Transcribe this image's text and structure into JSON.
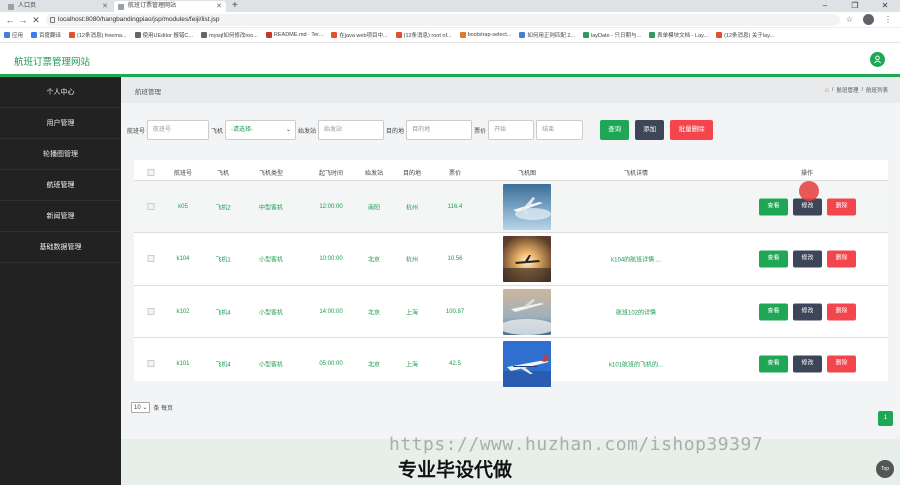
{
  "browser": {
    "tabs": [
      {
        "title": "人口页"
      },
      {
        "title": "航班订票管理网站"
      }
    ],
    "new_tab": "+",
    "url": "localhost:8080/hangbandingpiao/jsp/modules/feiji/list.jsp",
    "bookmarks": [
      {
        "label": "应用",
        "color": "#4a7bd8"
      },
      {
        "label": "百度翻译",
        "color": "#3b7cf0"
      },
      {
        "label": "(12条消息) freema...",
        "color": "#e0512d"
      },
      {
        "label": "使用UEditor 报错C...",
        "color": "#666666"
      },
      {
        "label": "mysql如何修改roo...",
        "color": "#666666"
      },
      {
        "label": "README.md · Ter...",
        "color": "#c43a2e"
      },
      {
        "label": "在java web项目中...",
        "color": "#e0512d"
      },
      {
        "label": "(12条消息) root of...",
        "color": "#e0512d"
      },
      {
        "label": "bootstrap-select...",
        "color": "#e07a2d"
      },
      {
        "label": "如何用正则匹配 2...",
        "color": "#4a7bd8"
      },
      {
        "label": "layDate - 只日期与...",
        "color": "#2d9c5a"
      },
      {
        "label": "表单模块文档 - Lay...",
        "color": "#2d9c5a"
      },
      {
        "label": "(12条消息) 关于lay...",
        "color": "#e0512d"
      }
    ]
  },
  "app": {
    "title": "航班订票管理网站",
    "accent": "#1fa756"
  },
  "sidebar": {
    "items": [
      {
        "label": "个人中心"
      },
      {
        "label": "用户管理"
      },
      {
        "label": "轮播图管理"
      },
      {
        "label": "航班管理"
      },
      {
        "label": "新闻管理"
      },
      {
        "label": "基础数据管理"
      }
    ]
  },
  "page": {
    "title": "航班管理",
    "breadcrumb": [
      "航班管理",
      "航班列表"
    ]
  },
  "search": {
    "flight_no_label": "航班号",
    "flight_no_placeholder": "航班号",
    "plane_label": "飞机",
    "plane_select_value": "-请选择-",
    "depart_label": "始发站",
    "depart_placeholder": "始发站",
    "dest_label": "目的地",
    "dest_placeholder": "目的地",
    "price_label": "票价",
    "price_start_placeholder": "开始",
    "price_end_placeholder": "结束",
    "query_button": "查询",
    "add_button": "添加",
    "batch_delete_button": "批量删除"
  },
  "table": {
    "columns": [
      "航班号",
      "飞机",
      "飞机类型",
      "起飞时间",
      "始发站",
      "目的地",
      "票价",
      "飞机图",
      "飞机详情",
      "操作"
    ],
    "rows": [
      {
        "flight_no": "k05",
        "plane": "飞机2",
        "type": "中型客机",
        "time": "12:00:00",
        "depart": "南阳",
        "dest": "杭州",
        "price": "116.4",
        "detail": ""
      },
      {
        "flight_no": "k104",
        "plane": "飞机1",
        "type": "小型客机",
        "time": "10:00:00",
        "depart": "北京",
        "dest": "杭州",
        "price": "10.56",
        "detail": "k104的航班详情 ..."
      },
      {
        "flight_no": "k102",
        "plane": "飞机4",
        "type": "小型客机",
        "time": "14:00:00",
        "depart": "北京",
        "dest": "上海",
        "price": "100.87",
        "detail": "航班102的详情"
      },
      {
        "flight_no": "k101",
        "plane": "飞机4",
        "type": "小型客机",
        "time": "05:00:00",
        "depart": "北京",
        "dest": "上海",
        "price": "42.5",
        "detail": "k101航班的飞机的..."
      }
    ],
    "actions": {
      "view": "查看",
      "edit": "修改",
      "delete": "删除"
    }
  },
  "pagination": {
    "page_size": "10",
    "page_size_suffix": "条 每页",
    "current_page": "1"
  },
  "overlay": {
    "watermark_url": "https://www.huzhan.com/ishop39397",
    "watermark_text": "专业毕设代做",
    "top_button": "Top"
  }
}
